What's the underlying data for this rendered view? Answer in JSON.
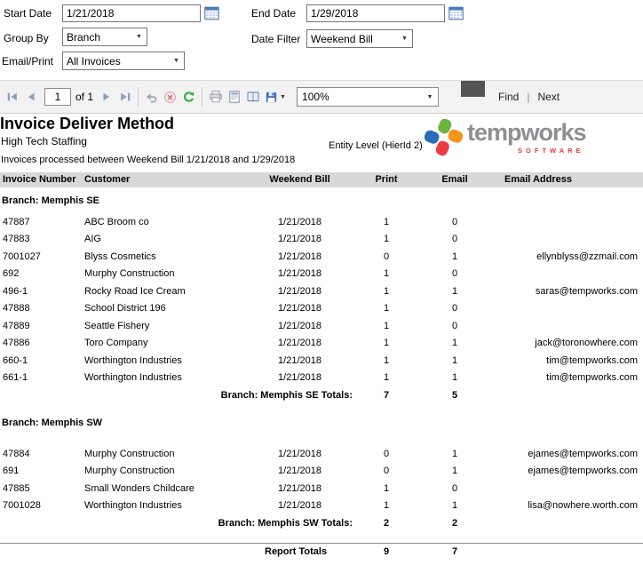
{
  "colors": {
    "table_header_bg": "#d8d8d8",
    "brand_gray": "#8d8f92",
    "brand_red": "#e23b33",
    "logo_green": "#6cb33f",
    "logo_orange": "#f7941d",
    "logo_blue": "#2b6cb8",
    "logo_piece_red": "#ed3b43"
  },
  "params": {
    "start_date": {
      "label": "Start Date",
      "value": "1/21/2018"
    },
    "end_date": {
      "label": "End Date",
      "value": "1/29/2018"
    },
    "group_by": {
      "label": "Group By",
      "value": "Branch"
    },
    "date_filter": {
      "label": "Date Filter",
      "value": "Weekend Bill"
    },
    "email_print": {
      "label": "Email/Print",
      "value": "All Invoices"
    }
  },
  "toolbar": {
    "page": "1",
    "of": "of 1",
    "zoom": "100%",
    "find": "Find",
    "divider": "|",
    "next": "Next",
    "caret": "▼"
  },
  "report": {
    "title": "Invoice Deliver Method",
    "company": "High Tech Staffing",
    "entity_level": "Entity Level (HierId 2)",
    "subtitle": "Invoices processed between Weekend Bill 1/21/2018 and 1/29/2018",
    "logo": {
      "brand": "tempworks",
      "software": "SOFTWARE"
    },
    "columns": [
      "Invoice Number",
      "Customer",
      "Weekend Bill",
      "Print",
      "Email",
      "Email Address"
    ],
    "groups": [
      {
        "name": "Branch: Memphis SE",
        "rows": [
          [
            "47887",
            "ABC Broom co",
            "1/21/2018",
            "1",
            "0",
            ""
          ],
          [
            "47883",
            "AIG",
            "1/21/2018",
            "1",
            "0",
            ""
          ],
          [
            "7001027",
            "Blyss Cosmetics",
            "1/21/2018",
            "0",
            "1",
            "ellynblyss@zzmail.com"
          ],
          [
            "692",
            "Murphy Construction",
            "1/21/2018",
            "1",
            "0",
            ""
          ],
          [
            "496-1",
            "Rocky Road Ice Cream",
            "1/21/2018",
            "1",
            "1",
            "saras@tempworks.com"
          ],
          [
            "47888",
            "School District 196",
            "1/21/2018",
            "1",
            "0",
            ""
          ],
          [
            "47889",
            "Seattle Fishery",
            "1/21/2018",
            "1",
            "0",
            ""
          ],
          [
            "47886",
            "Toro Company",
            "1/21/2018",
            "1",
            "1",
            "jack@toronowhere.com"
          ],
          [
            "660-1",
            "Worthington Industries",
            "1/21/2018",
            "1",
            "1",
            "tim@tempworks.com"
          ],
          [
            "661-1",
            "Worthington Industries",
            "1/21/2018",
            "1",
            "1",
            "tim@tempworks.com"
          ]
        ],
        "totals_label": "Branch: Memphis SE Totals:",
        "print_total": "7",
        "email_total": "5"
      },
      {
        "name": "Branch: Memphis SW",
        "rows": [
          [
            "47884",
            "Murphy Construction",
            "1/21/2018",
            "0",
            "1",
            "ejames@tempworks.com"
          ],
          [
            "691",
            "Murphy Construction",
            "1/21/2018",
            "0",
            "1",
            "ejames@tempworks.com"
          ],
          [
            "47885",
            "Small Wonders Childcare",
            "1/21/2018",
            "1",
            "0",
            ""
          ],
          [
            "7001028",
            "Worthington Industries",
            "1/21/2018",
            "1",
            "1",
            "lisa@nowhere.worth.com"
          ]
        ],
        "totals_label": "Branch: Memphis SW  Totals:",
        "print_total": "2",
        "email_total": "2"
      }
    ],
    "report_totals": {
      "label": "Report Totals",
      "print": "9",
      "email": "7"
    }
  }
}
